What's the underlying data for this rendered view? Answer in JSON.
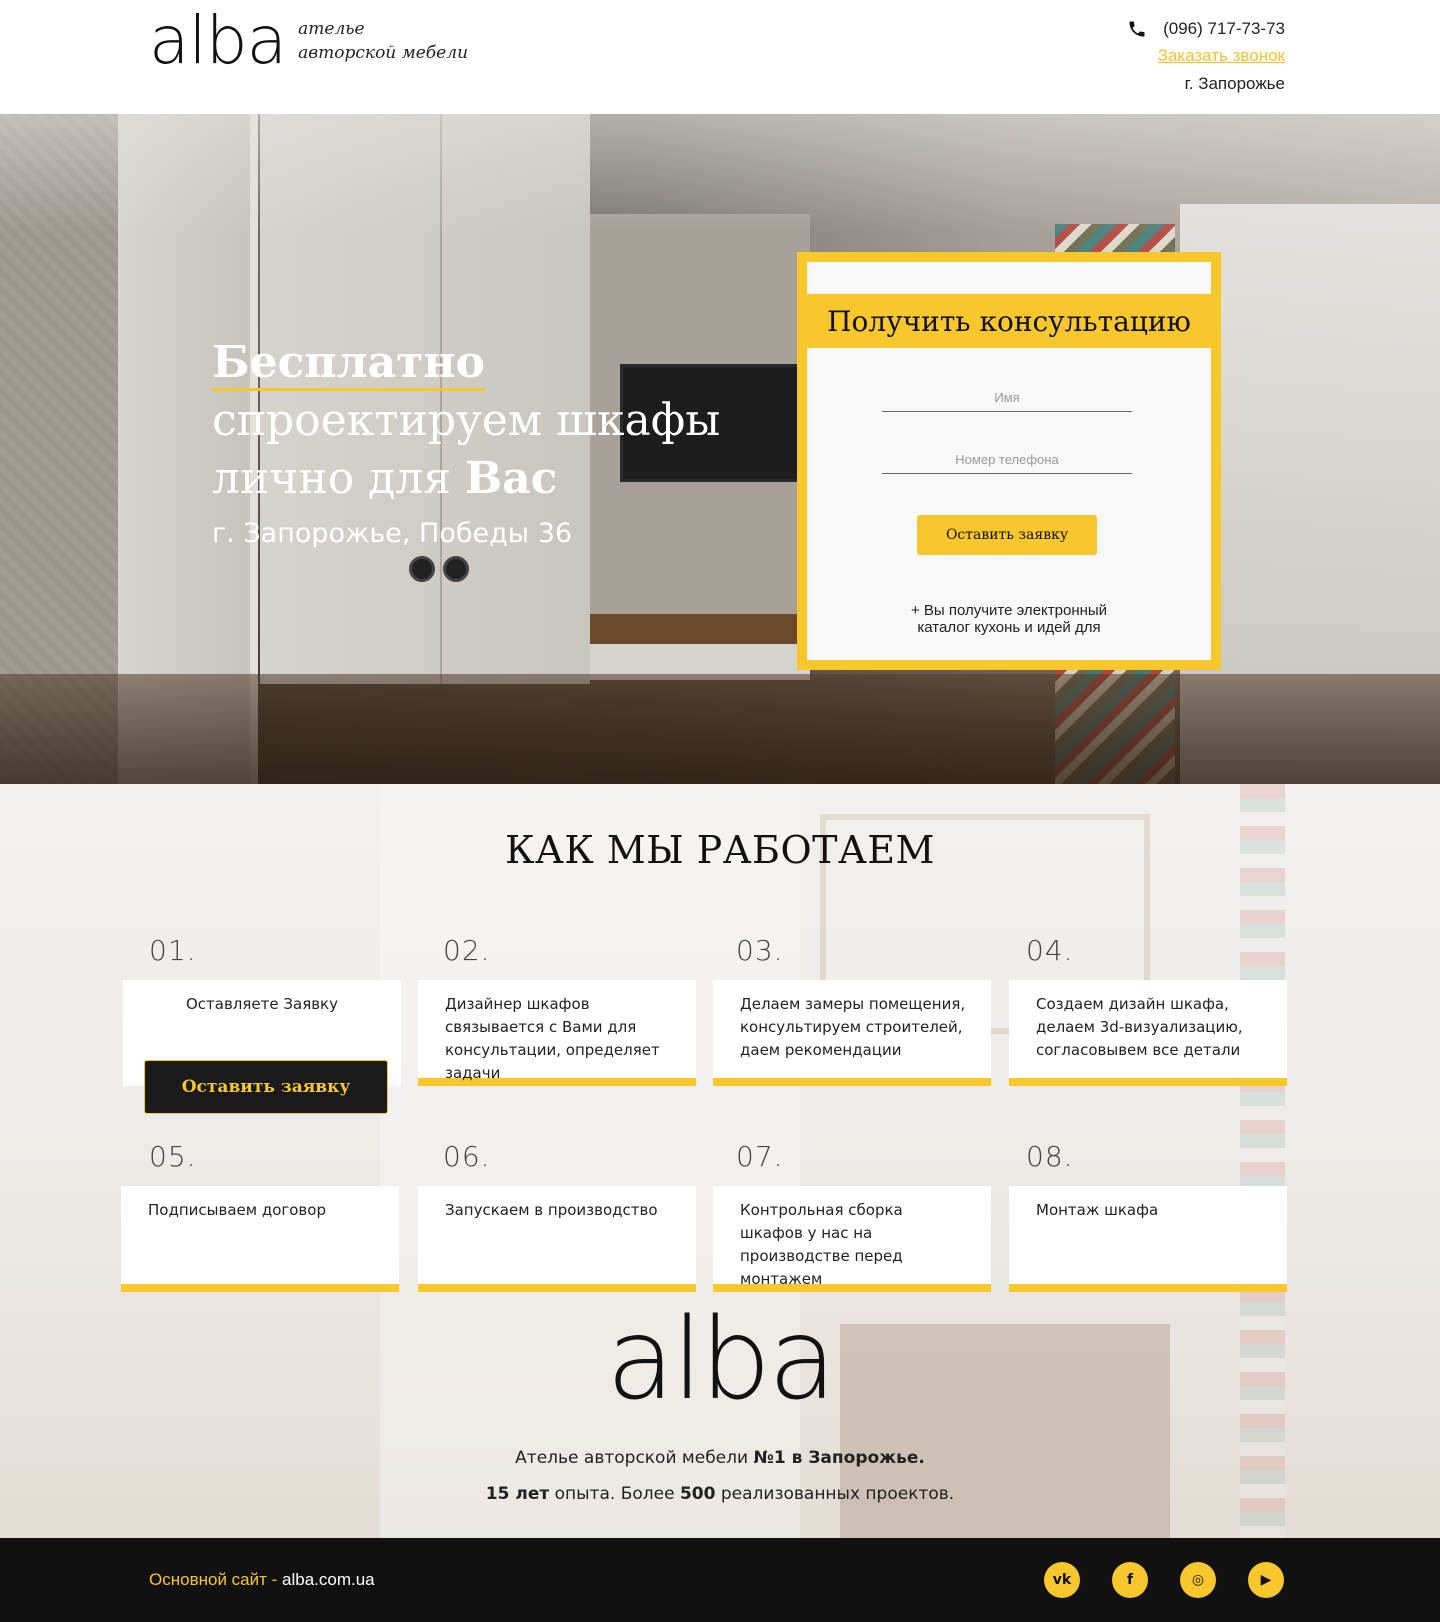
{
  "header": {
    "logo_word": "alba",
    "logo_tag_line1": "ателье",
    "logo_tag_line2": "авторской мебели",
    "phone": "(096) 717-73-73",
    "callback_link": "Заказать звонок",
    "city": "г. Запорожье"
  },
  "hero": {
    "line1": "Бесплатно",
    "line2": "спроектируем шкафы",
    "line3_prefix": "лично для ",
    "line3_bold": "Вас",
    "address": "г. Запорожье, Победы 36"
  },
  "form": {
    "title": "Получить консультацию",
    "name_placeholder": "Имя",
    "phone_placeholder": "Номер телефона",
    "submit_label": "Оставить заявку",
    "note_line1": "+ Вы получите электронный",
    "note_line2": "каталог кухонь и идей для"
  },
  "work": {
    "title": "КАК МЫ РАБОТАЕМ",
    "cta_label": "Оставить заявку",
    "steps": [
      {
        "num": "01.",
        "text": "Оставляете Заявку"
      },
      {
        "num": "02.",
        "text": "Дизайнер шкафов связывается с Вами для консультации, определяет задачи"
      },
      {
        "num": "03.",
        "text": "Делаем замеры помещения, консультируем строителей, даем рекомендации"
      },
      {
        "num": "04.",
        "text": "Создаем дизайн шкафа, делаем 3d-визуализацию, согласовывем все детали"
      },
      {
        "num": "05.",
        "text": "Подписываем договор"
      },
      {
        "num": "06.",
        "text": "Запускаем в производство"
      },
      {
        "num": "07.",
        "text": "Контрольная сборка шкафов  у нас на производстве перед монтажем"
      },
      {
        "num": "08.",
        "text": "Монтаж шкафа"
      }
    ]
  },
  "about": {
    "logo_word": "alba",
    "line1_prefix": "Ателье авторской мебели ",
    "line1_bold": "№1 в Запорожье.",
    "line2_bold1": "15 лет",
    "line2_mid": " опыта. Более ",
    "line2_bold2": "500",
    "line2_suffix": " реализованных проектов."
  },
  "footer": {
    "site_label": "Основной сайт - ",
    "site_link": "alba.com.ua",
    "socials": [
      {
        "icon": "vk-icon",
        "glyph": "vk"
      },
      {
        "icon": "facebook-icon",
        "glyph": "f"
      },
      {
        "icon": "instagram-icon",
        "glyph": "◎"
      },
      {
        "icon": "youtube-icon",
        "glyph": "▶"
      }
    ]
  },
  "colors": {
    "accent": "#f7c72c",
    "dark": "#111111",
    "link": "#f2c12e"
  }
}
